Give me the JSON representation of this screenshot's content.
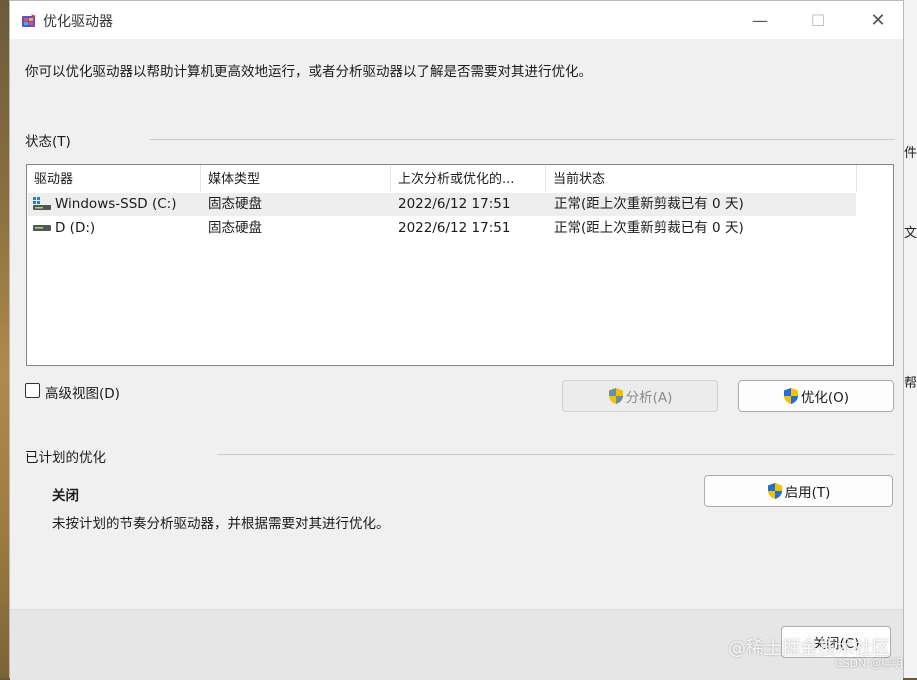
{
  "window": {
    "title": "优化驱动器",
    "close_glyph": "✕",
    "min_glyph": "—",
    "max_glyph": "☐"
  },
  "description": "你可以优化驱动器以帮助计算机更高效地运行，或者分析驱动器以了解是否需要对其进行优化。",
  "status": {
    "label": "状态(T)",
    "columns": [
      "驱动器",
      "媒体类型",
      "上次分析或优化的...",
      "当前状态"
    ],
    "rows": [
      {
        "drive": "Windows-SSD (C:)",
        "media": "固态硬盘",
        "last": "2022/6/12 17:51",
        "state": "正常(距上次重新剪裁已有 0 天)",
        "icon": "windows-drive-icon"
      },
      {
        "drive": "D (D:)",
        "media": "固态硬盘",
        "last": "2022/6/12 17:51",
        "state": "正常(距上次重新剪裁已有 0 天)",
        "icon": "drive-icon"
      }
    ]
  },
  "advanced_view_label": "高级视图(D)",
  "buttons": {
    "analyze": "分析(A)",
    "optimize": "优化(O)",
    "enable": "启用(T)",
    "close": "关闭(C)"
  },
  "scheduled": {
    "label": "已计划的优化",
    "state_title": "关闭",
    "state_desc": "未按计划的节奏分析驱动器，并根据需要对其进行优化。"
  },
  "background_chars": [
    "件",
    "文",
    "帮"
  ],
  "watermark": {
    "main": "@稀土掘金技术社区",
    "sub": "CSDN @檸明"
  }
}
